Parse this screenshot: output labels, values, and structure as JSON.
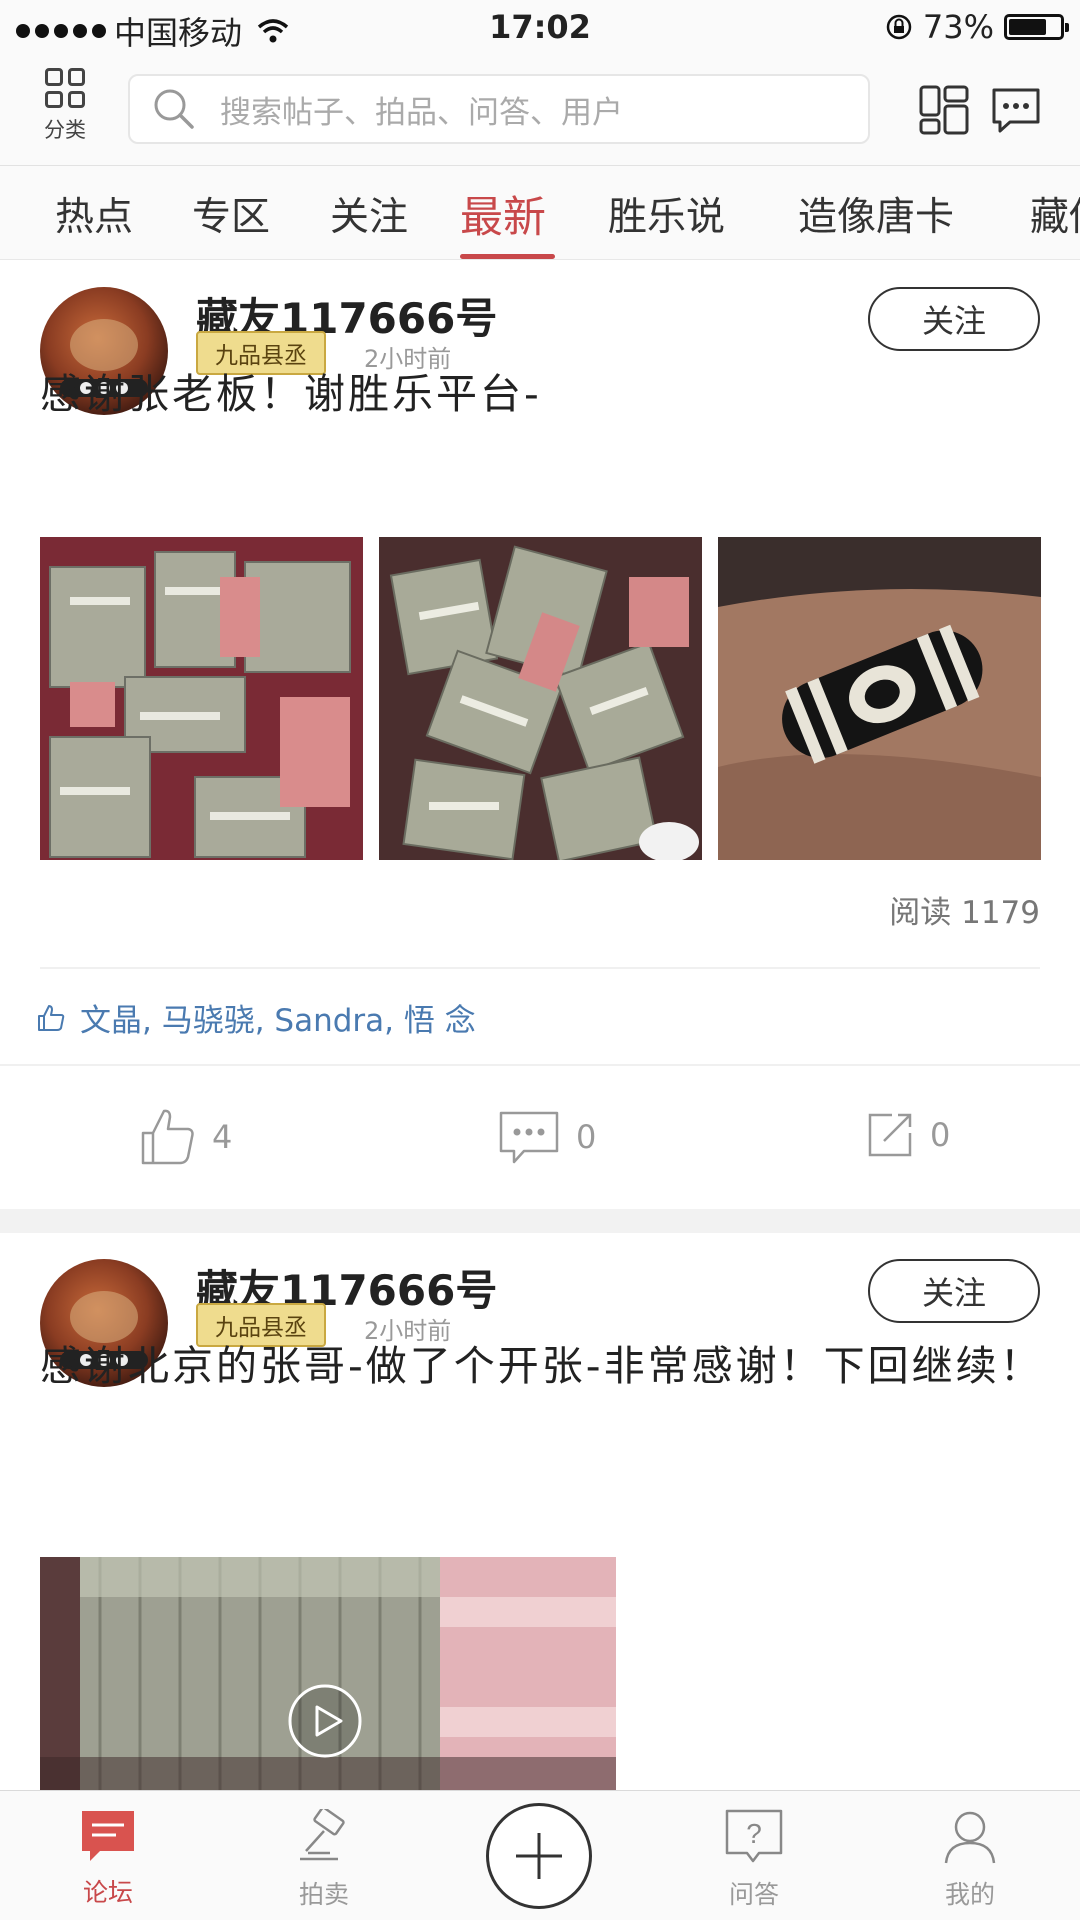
{
  "status_bar": {
    "carrier": "中国移动",
    "time": "17:02",
    "battery_percent": "73%",
    "battery_level": 0.73
  },
  "header": {
    "category_label": "分类",
    "search_placeholder": "搜索帖子、拍品、问答、用户"
  },
  "tabs": [
    {
      "label": "热点"
    },
    {
      "label": "专区"
    },
    {
      "label": "关注"
    },
    {
      "label": "最新",
      "active": true
    },
    {
      "label": "胜乐说"
    },
    {
      "label": "造像唐卡"
    },
    {
      "label": "藏传"
    }
  ],
  "posts": [
    {
      "username": "藏友117666号",
      "rank": "九品县丞",
      "time": "2小时前",
      "follow_label": "关注",
      "text": "感谢张老板！谢胜乐平台-",
      "read_count": "阅读 1179",
      "likers": "文晶, 马骁骁, Sandra, 悟  念",
      "like_count": "4",
      "comment_count": "0",
      "share_count": "0"
    },
    {
      "username": "藏友117666号",
      "rank": "九品县丞",
      "time": "2小时前",
      "follow_label": "关注",
      "text": "感谢北京的张哥-做了个开张-非常感谢！下回继续！"
    }
  ],
  "bottom_nav": [
    {
      "label": "论坛",
      "icon": "forum-icon",
      "active": true
    },
    {
      "label": "拍卖",
      "icon": "auction-hammer-icon"
    },
    {
      "label": "",
      "icon": "plus-icon"
    },
    {
      "label": "问答",
      "icon": "question-icon"
    },
    {
      "label": "我的",
      "icon": "profile-icon"
    }
  ],
  "colors": {
    "accent": "#c8484a",
    "link": "#4a7ab0",
    "badge_bg": "#efdc8e"
  }
}
